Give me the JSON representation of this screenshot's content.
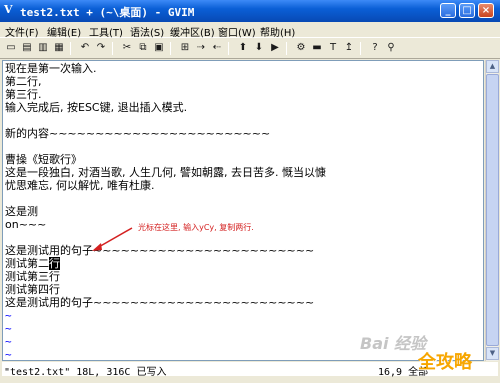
{
  "window": {
    "title": "test2.txt + (~\\桌面) - GVIM",
    "app_icon": "vim-icon",
    "controls": [
      "_",
      "□",
      "×"
    ]
  },
  "menu": [
    "文件(F)",
    "编辑(E)",
    "工具(T)",
    "语法(S)",
    "缓冲区(B)",
    "窗口(W)",
    "帮助(H)"
  ],
  "toolbar_icons": [
    "open-icon",
    "save-icon",
    "save-all-icon",
    "print-icon",
    "undo-icon",
    "redo-icon",
    "cut-icon",
    "copy-icon",
    "paste-icon",
    "find-replace-icon",
    "find-next-icon",
    "find-prev-icon",
    "load-session-icon",
    "save-session-icon",
    "run-script-icon",
    "make-icon",
    "shell-icon",
    "ctags-icon",
    "jump-tag-icon",
    "help-icon",
    "search-help-icon"
  ],
  "toolbar_glyphs": [
    "▭",
    "▤",
    "▥",
    "▦",
    "↶",
    "↷",
    "✂",
    "⧉",
    "▣",
    "⊞",
    "⇢",
    "⇠",
    "⬆",
    "⬇",
    "▶",
    "⚙",
    "▬",
    "T",
    "↥",
    "?",
    "⚲"
  ],
  "editor": {
    "lines": [
      "现在是第一次输入.",
      "第二行,",
      "第三行.",
      "输入完成后, 按ESC键, 退出插入模式.",
      "",
      "新的内容~~~~~~~~~~~~~~~~~~~~~~~~",
      "",
      "曹操《短歌行》",
      "这是一段独白, 对酒当歌, 人生几何, 譬如朝露, 去日苦多. 慨当以慷",
      "忧思难忘, 何以解忧, 唯有杜康.",
      "",
      "这是测",
      "  on~~~",
      "",
      "这是测试用的句子~~~~~~~~~~~~~~~~~~~~~~~~",
      "测试第二行",
      "测试第三行",
      "测试第四行",
      "这是测试用的句子~~~~~~~~~~~~~~~~~~~~~~~~"
    ],
    "cursor_line": 15,
    "cursor_char": "行",
    "tilde": "~",
    "tilde_count": 4
  },
  "annotation": "光标在这里, 输入yCy, 复制两行.",
  "status": {
    "left": "\"test2.txt\" 18L, 316C 已写入",
    "right": "16,9 全部"
  },
  "watermark": "Bai 经验",
  "logo": "全攻略",
  "colors": {
    "title_bar": "#0a5fd6",
    "annotation": "#d42020",
    "tilde": "#0000ff",
    "logo": "#f7a600"
  }
}
